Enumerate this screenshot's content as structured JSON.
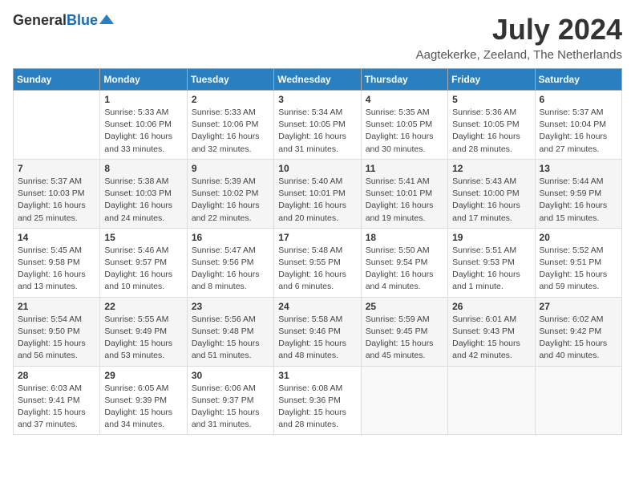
{
  "header": {
    "logo_line1": "General",
    "logo_line2": "Blue",
    "title": "July 2024",
    "subtitle": "Aagtekerke, Zeeland, The Netherlands"
  },
  "days_of_week": [
    "Sunday",
    "Monday",
    "Tuesday",
    "Wednesday",
    "Thursday",
    "Friday",
    "Saturday"
  ],
  "weeks": [
    [
      {
        "day": "",
        "info": ""
      },
      {
        "day": "1",
        "info": "Sunrise: 5:33 AM\nSunset: 10:06 PM\nDaylight: 16 hours\nand 33 minutes."
      },
      {
        "day": "2",
        "info": "Sunrise: 5:33 AM\nSunset: 10:06 PM\nDaylight: 16 hours\nand 32 minutes."
      },
      {
        "day": "3",
        "info": "Sunrise: 5:34 AM\nSunset: 10:05 PM\nDaylight: 16 hours\nand 31 minutes."
      },
      {
        "day": "4",
        "info": "Sunrise: 5:35 AM\nSunset: 10:05 PM\nDaylight: 16 hours\nand 30 minutes."
      },
      {
        "day": "5",
        "info": "Sunrise: 5:36 AM\nSunset: 10:05 PM\nDaylight: 16 hours\nand 28 minutes."
      },
      {
        "day": "6",
        "info": "Sunrise: 5:37 AM\nSunset: 10:04 PM\nDaylight: 16 hours\nand 27 minutes."
      }
    ],
    [
      {
        "day": "7",
        "info": "Sunrise: 5:37 AM\nSunset: 10:03 PM\nDaylight: 16 hours\nand 25 minutes."
      },
      {
        "day": "8",
        "info": "Sunrise: 5:38 AM\nSunset: 10:03 PM\nDaylight: 16 hours\nand 24 minutes."
      },
      {
        "day": "9",
        "info": "Sunrise: 5:39 AM\nSunset: 10:02 PM\nDaylight: 16 hours\nand 22 minutes."
      },
      {
        "day": "10",
        "info": "Sunrise: 5:40 AM\nSunset: 10:01 PM\nDaylight: 16 hours\nand 20 minutes."
      },
      {
        "day": "11",
        "info": "Sunrise: 5:41 AM\nSunset: 10:01 PM\nDaylight: 16 hours\nand 19 minutes."
      },
      {
        "day": "12",
        "info": "Sunrise: 5:43 AM\nSunset: 10:00 PM\nDaylight: 16 hours\nand 17 minutes."
      },
      {
        "day": "13",
        "info": "Sunrise: 5:44 AM\nSunset: 9:59 PM\nDaylight: 16 hours\nand 15 minutes."
      }
    ],
    [
      {
        "day": "14",
        "info": "Sunrise: 5:45 AM\nSunset: 9:58 PM\nDaylight: 16 hours\nand 13 minutes."
      },
      {
        "day": "15",
        "info": "Sunrise: 5:46 AM\nSunset: 9:57 PM\nDaylight: 16 hours\nand 10 minutes."
      },
      {
        "day": "16",
        "info": "Sunrise: 5:47 AM\nSunset: 9:56 PM\nDaylight: 16 hours\nand 8 minutes."
      },
      {
        "day": "17",
        "info": "Sunrise: 5:48 AM\nSunset: 9:55 PM\nDaylight: 16 hours\nand 6 minutes."
      },
      {
        "day": "18",
        "info": "Sunrise: 5:50 AM\nSunset: 9:54 PM\nDaylight: 16 hours\nand 4 minutes."
      },
      {
        "day": "19",
        "info": "Sunrise: 5:51 AM\nSunset: 9:53 PM\nDaylight: 16 hours\nand 1 minute."
      },
      {
        "day": "20",
        "info": "Sunrise: 5:52 AM\nSunset: 9:51 PM\nDaylight: 15 hours\nand 59 minutes."
      }
    ],
    [
      {
        "day": "21",
        "info": "Sunrise: 5:54 AM\nSunset: 9:50 PM\nDaylight: 15 hours\nand 56 minutes."
      },
      {
        "day": "22",
        "info": "Sunrise: 5:55 AM\nSunset: 9:49 PM\nDaylight: 15 hours\nand 53 minutes."
      },
      {
        "day": "23",
        "info": "Sunrise: 5:56 AM\nSunset: 9:48 PM\nDaylight: 15 hours\nand 51 minutes."
      },
      {
        "day": "24",
        "info": "Sunrise: 5:58 AM\nSunset: 9:46 PM\nDaylight: 15 hours\nand 48 minutes."
      },
      {
        "day": "25",
        "info": "Sunrise: 5:59 AM\nSunset: 9:45 PM\nDaylight: 15 hours\nand 45 minutes."
      },
      {
        "day": "26",
        "info": "Sunrise: 6:01 AM\nSunset: 9:43 PM\nDaylight: 15 hours\nand 42 minutes."
      },
      {
        "day": "27",
        "info": "Sunrise: 6:02 AM\nSunset: 9:42 PM\nDaylight: 15 hours\nand 40 minutes."
      }
    ],
    [
      {
        "day": "28",
        "info": "Sunrise: 6:03 AM\nSunset: 9:41 PM\nDaylight: 15 hours\nand 37 minutes."
      },
      {
        "day": "29",
        "info": "Sunrise: 6:05 AM\nSunset: 9:39 PM\nDaylight: 15 hours\nand 34 minutes."
      },
      {
        "day": "30",
        "info": "Sunrise: 6:06 AM\nSunset: 9:37 PM\nDaylight: 15 hours\nand 31 minutes."
      },
      {
        "day": "31",
        "info": "Sunrise: 6:08 AM\nSunset: 9:36 PM\nDaylight: 15 hours\nand 28 minutes."
      },
      {
        "day": "",
        "info": ""
      },
      {
        "day": "",
        "info": ""
      },
      {
        "day": "",
        "info": ""
      }
    ]
  ]
}
